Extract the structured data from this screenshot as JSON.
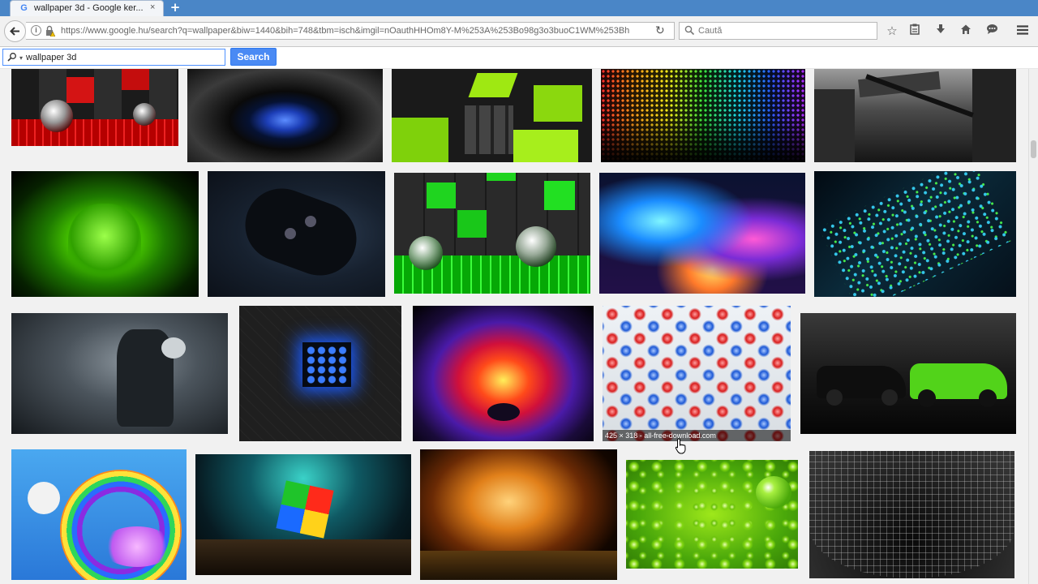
{
  "browser": {
    "tab_title": "wallpaper 3d - Google ker...",
    "tab_close": "×",
    "new_tab": "+",
    "url": "https://www.google.hu/search?q=wallpaper&biw=1440&bih=748&tbm=isch&imgil=nOauthHHOm8Y-M%253A%253Bo98g3o3buoC1WM%253Bh",
    "search_placeholder": "Caută"
  },
  "google": {
    "query": "wallpaper 3d",
    "search_label": "Search"
  },
  "results": [
    {
      "name": "red-black-cubes-spheres"
    },
    {
      "name": "blue-eye"
    },
    {
      "name": "green-tiles-3d"
    },
    {
      "name": "rainbow-dots-wave"
    },
    {
      "name": "city-train-bw"
    },
    {
      "name": "green-neon-lion"
    },
    {
      "name": "gamepad-dark"
    },
    {
      "name": "green-cubes-spheres"
    },
    {
      "name": "colorful-smoke-clouds"
    },
    {
      "name": "blue-green-squares-abstract"
    },
    {
      "name": "dark-warrior"
    },
    {
      "name": "glowing-blue-cube"
    },
    {
      "name": "neon-wolf"
    },
    {
      "name": "glass-marbles",
      "caption": "425 × 318 - all-free-download.com"
    },
    {
      "name": "muscle-cars"
    },
    {
      "name": "rainbow-cartoon"
    },
    {
      "name": "rubiks-cube"
    },
    {
      "name": "neon-kitten"
    },
    {
      "name": "green-water-drops"
    },
    {
      "name": "grid-wave-bw"
    }
  ]
}
